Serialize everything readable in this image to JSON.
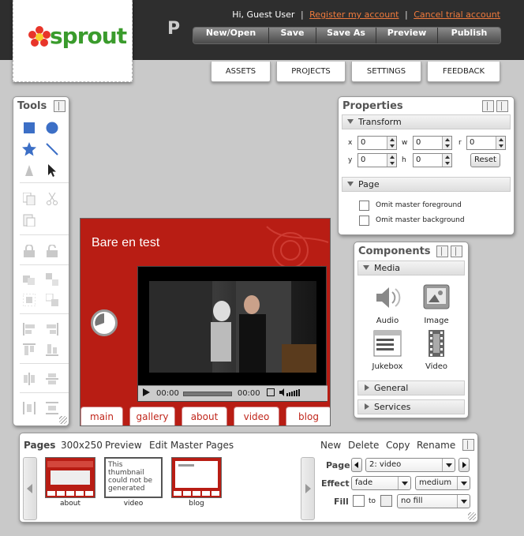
{
  "header": {
    "logo_text": "sprout",
    "project_letter": "P",
    "greeting": "Hi, Guest User",
    "register_link": "Register my account",
    "separator": "|",
    "cancel_link": "Cancel trial account",
    "actions": [
      "New/Open",
      "Save",
      "Save As",
      "Preview",
      "Publish"
    ],
    "tabs": [
      "ASSETS",
      "PROJECTS",
      "SETTINGS",
      "FEEDBACK"
    ]
  },
  "tools": {
    "title": "Tools",
    "icons": [
      "rectangle-tool-icon",
      "ellipse-tool-icon",
      "star-tool-icon",
      "line-tool-icon",
      "text-tool-icon",
      "select-arrow-icon",
      "copy-icon",
      "cut-icon",
      "paste-icon",
      "lock-icon",
      "unlock-icon",
      "group-icon",
      "ungroup-icon",
      "align-left-icon",
      "align-right-icon",
      "align-top-icon",
      "align-bottom-icon",
      "distribute-h-icon",
      "distribute-v-icon"
    ]
  },
  "canvas": {
    "title": "Bare en test",
    "video_time_current": "00:00",
    "video_time_total": "00:00",
    "nav": [
      "main",
      "gallery",
      "about",
      "video",
      "blog"
    ],
    "accent_color": "#b81d14"
  },
  "properties": {
    "title": "Properties",
    "transform_label": "Transform",
    "fields": {
      "x_label": "x",
      "x_value": "0",
      "w_label": "w",
      "w_value": "0",
      "r_label": "r",
      "r_value": "0",
      "y_label": "y",
      "y_value": "0",
      "h_label": "h",
      "h_value": "0"
    },
    "reset_label": "Reset",
    "page_label": "Page",
    "omit_foreground": "Omit master foreground",
    "omit_background": "Omit master background"
  },
  "components": {
    "title": "Components",
    "media_label": "Media",
    "items": [
      "Audio",
      "Image",
      "Jukebox",
      "Video"
    ],
    "general_label": "General",
    "services_label": "Services"
  },
  "pages": {
    "title": "Pages",
    "size": "300x250",
    "preview": "Preview",
    "edit_master": "Edit Master Pages",
    "new": "New",
    "delete": "Delete",
    "copy": "Copy",
    "rename": "Rename",
    "thumbs": [
      {
        "label": "about"
      },
      {
        "label": "video",
        "placeholder": "This thumbnail could not be generated"
      },
      {
        "label": "blog"
      }
    ],
    "page_label": "Page",
    "page_value": "2: video",
    "effect_label": "Effect",
    "effect_value": "fade",
    "speed_value": "medium",
    "fill_label": "Fill",
    "fill_to": "to",
    "fill_value": "no fill"
  }
}
